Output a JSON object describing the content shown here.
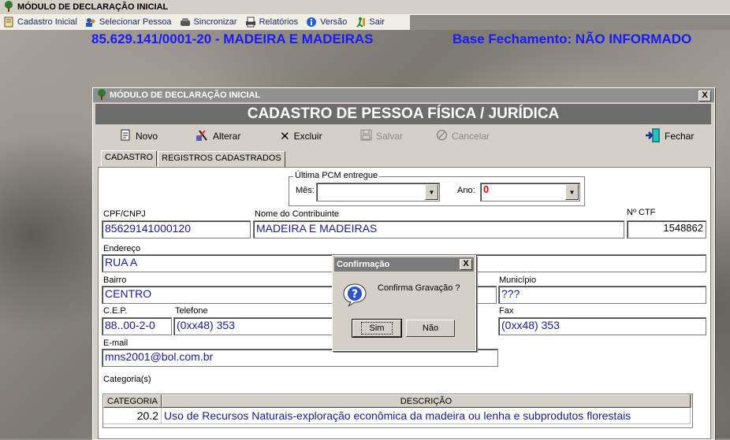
{
  "app": {
    "title": "MÓDULO DE DECLARAÇÃO INICIAL"
  },
  "menu": [
    {
      "label": "Cadastro Inicial",
      "icon": "notebook-icon"
    },
    {
      "label": "Selecionar Pessoa",
      "icon": "users-icon"
    },
    {
      "label": "Sincronizar",
      "icon": "phone-icon"
    },
    {
      "label": "Relatórios",
      "icon": "printer-icon"
    },
    {
      "label": "Versão",
      "icon": "info-icon"
    },
    {
      "label": "Sair",
      "icon": "exit-icon"
    }
  ],
  "header": {
    "firm": "85.629.141/0001-20 - MADEIRA E MADEIRAS",
    "base": "Base Fechamento: NÃO INFORMADO"
  },
  "window": {
    "title": "MÓDULO DE DECLARAÇÃO INICIAL",
    "close": "X",
    "form_title": "CADASTRO DE PESSOA FÍSICA / JURÍDICA"
  },
  "toolbar": {
    "novo": "Novo",
    "alterar": "Alterar",
    "excluir": "Excluir",
    "salvar": "Salvar",
    "cancelar": "Cancelar",
    "fechar": "Fechar"
  },
  "tabs": [
    "CADASTRO",
    "REGISTROS CADASTRADOS"
  ],
  "form": {
    "pcm_group": "Última PCM entregue",
    "mes_label": "Mês:",
    "mes_value": "",
    "ano_label": "Ano:",
    "ano_value": "0",
    "cpf_label": "CPF/CNPJ",
    "cpf_value": "85629141000120",
    "nome_label": "Nome do Contribuinte",
    "nome_value": "MADEIRA E MADEIRAS",
    "ctf_label": "Nº CTF",
    "ctf_value": "1548862",
    "endereco_label": "Endereço",
    "endereco_value": "RUA A",
    "bairro_label": "Bairro",
    "bairro_value": "CENTRO",
    "municipio_label": "Município",
    "municipio_value": "???",
    "cep_label": "C.E.P.",
    "cep_value": "88..00-2-0",
    "telefone_label": "Telefone",
    "telefone_value": "(0xx48) 353",
    "fax_label": "Fax",
    "fax_value": "(0xx48) 353",
    "email_label": "E-mail",
    "email_value": "mns2001@bol.com.br",
    "categorias_label": "Categoria(s)"
  },
  "grid": {
    "headers": [
      "CATEGORIA",
      "DESCRIÇÃO"
    ],
    "rows": [
      {
        "categoria": "20.2",
        "descricao": "Uso de Recursos Naturais-exploração econômica da madeira ou lenha e subprodutos florestais"
      }
    ]
  },
  "modal": {
    "title": "Confirmação",
    "close": "X",
    "message": "Confirma Gravação ?",
    "yes": "Sim",
    "no": "Não",
    "icon": "question-icon"
  },
  "colors": {
    "accent": "#1a1aff",
    "field_text": "#1a1a99",
    "ano_value": "#e00000"
  }
}
